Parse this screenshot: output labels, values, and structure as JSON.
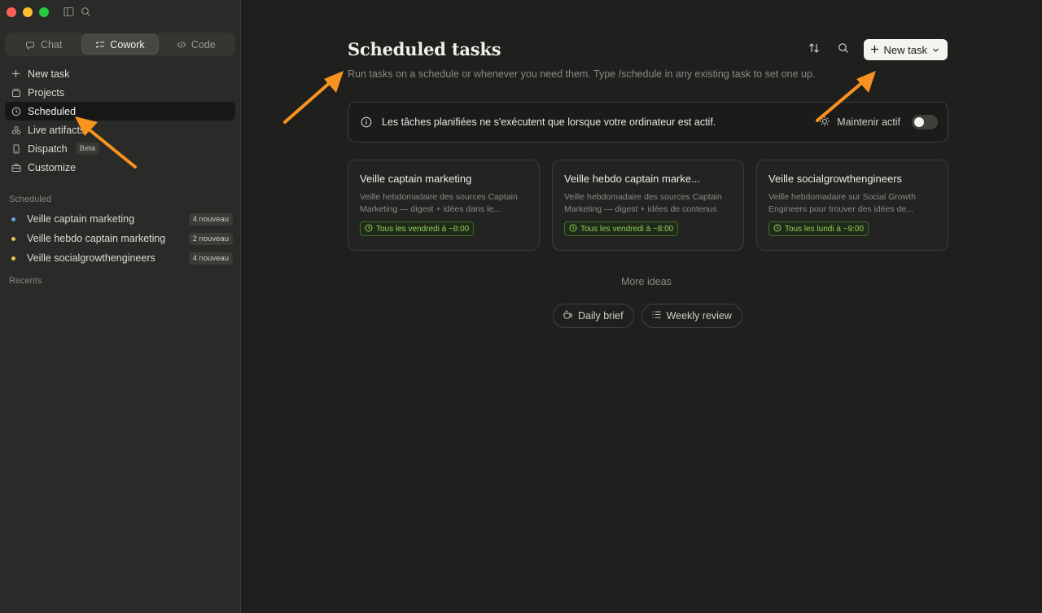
{
  "sidebar": {
    "modes": [
      {
        "label": "Chat",
        "icon": "chat-icon"
      },
      {
        "label": "Cowork",
        "icon": "cowork-icon",
        "active": true
      },
      {
        "label": "Code",
        "icon": "code-icon"
      }
    ],
    "nav": [
      {
        "label": "New task",
        "icon": "plus-icon"
      },
      {
        "label": "Projects",
        "icon": "folder-icon"
      },
      {
        "label": "Scheduled",
        "icon": "clock-icon",
        "active": true
      },
      {
        "label": "Live artifacts",
        "icon": "artifact-icon"
      },
      {
        "label": "Dispatch",
        "icon": "phone-icon",
        "badge": "Beta"
      },
      {
        "label": "Customize",
        "icon": "briefcase-icon"
      }
    ],
    "scheduled_label": "Scheduled",
    "scheduled_items": [
      {
        "name": "Veille captain marketing",
        "badge": "4 nouveau",
        "dot_color": "#6aa5e8"
      },
      {
        "name": "Veille hebdo captain marketing",
        "badge": "2 nouveau",
        "dot_color": "#e8c35a"
      },
      {
        "name": "Veille socialgrowthengineers",
        "badge": "4 nouveau",
        "dot_color": "#e8c35a"
      }
    ],
    "recents_label": "Recents"
  },
  "main": {
    "title": "Scheduled tasks",
    "subtitle": "Run tasks on a schedule or whenever you need them. Type /schedule in any existing task to set one up.",
    "new_task_label": "New task",
    "banner": {
      "message": "Les tâches planifiées ne s'exécutent que lorsque votre ordinateur est actif.",
      "keep_active_label": "Maintenir actif",
      "toggle_on": false
    },
    "cards": [
      {
        "title": "Veille captain marketing",
        "desc": "Veille hebdomadaire des sources Captain Marketing — digest + idées dans le...",
        "schedule": "Tous les vendredi à ~8:00"
      },
      {
        "title": "Veille hebdo captain marke...",
        "desc": "Veille hebdomadaire des sources Captain Marketing — digest + idées de contenus",
        "schedule": "Tous les vendredi à ~8:00"
      },
      {
        "title": "Veille socialgrowthengineers",
        "desc": "Veille hebdomadaire sur Social Growth Engineers pour trouver des idées de...",
        "schedule": "Tous les lundi à ~9:00"
      }
    ],
    "more_ideas_label": "More ideas",
    "ideas": [
      {
        "label": "Daily brief",
        "icon": "coffee-icon"
      },
      {
        "label": "Weekly review",
        "icon": "checklist-icon"
      }
    ]
  },
  "colors": {
    "annotation_arrow": "#f7931e",
    "schedule_pill_text": "#8fce5a"
  }
}
